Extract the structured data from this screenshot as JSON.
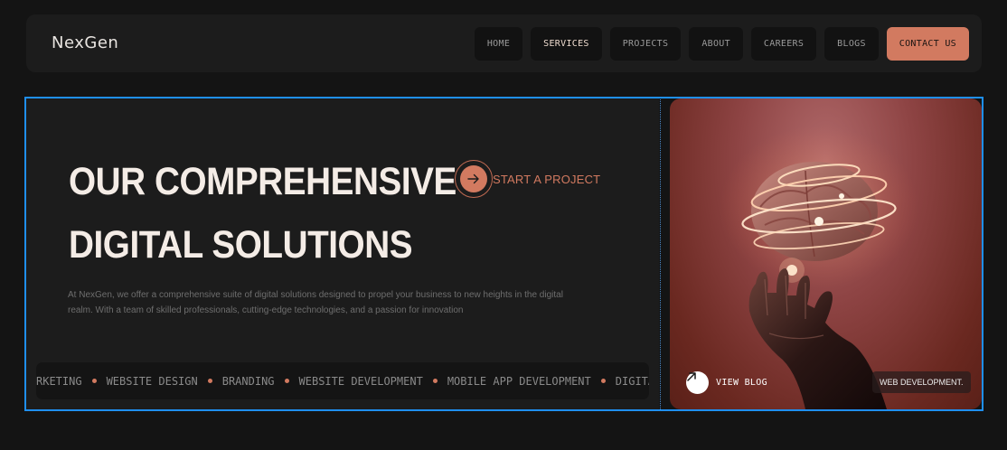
{
  "brand": {
    "logo": "NexGen"
  },
  "nav": {
    "items": [
      {
        "label": "HOME",
        "name": "nav-home"
      },
      {
        "label": "SERVICES",
        "name": "nav-services"
      },
      {
        "label": "PROJECTS",
        "name": "nav-projects"
      },
      {
        "label": "ABOUT",
        "name": "nav-about"
      },
      {
        "label": "CAREERS",
        "name": "nav-careers"
      },
      {
        "label": "BLOGS",
        "name": "nav-blogs"
      }
    ],
    "active": "SERVICES",
    "contact_label": "CONTACT US"
  },
  "hero": {
    "headline_line1": "OUR COMPREHENSIVE",
    "headline_line2": "DIGITAL SOLUTIONS",
    "cta_label": "START A PROJECT",
    "cta_icon": "arrow-right-icon",
    "description": "At NexGen, we offer a comprehensive suite of digital solutions designed to propel your business to new heights in the digital realm. With a team of skilled professionals, cutting-edge technologies, and a passion for innovation"
  },
  "ticker": {
    "items": [
      "RKETING",
      "WEBSITE DESIGN",
      "BRANDING",
      "WEBSITE DEVELOPMENT",
      "MOBILE APP DEVELOPMENT",
      "DIGITAL"
    ]
  },
  "card": {
    "view_blog_label": "VIEW BLOG",
    "view_blog_icon": "arrow-up-right-icon",
    "tag_label": "WEB DEVELOPMENT."
  },
  "colors": {
    "accent": "#d27a60",
    "background": "#141414",
    "panel": "#1c1c1c",
    "selection": "#1f8ff0"
  }
}
